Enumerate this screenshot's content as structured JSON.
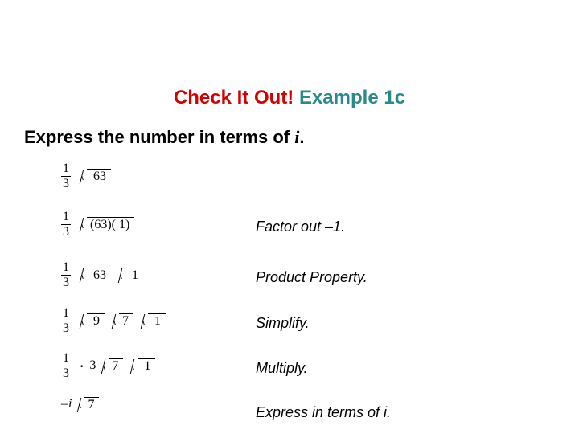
{
  "title": {
    "red": "Check It Out!",
    "teal": "Example 1c"
  },
  "prompt": {
    "a": "Express the number in terms of ",
    "i": "i",
    "b": "."
  },
  "frac": {
    "n": "1",
    "d": "3"
  },
  "rad": {
    "r1": " 63",
    "r2": "(63)( 1)",
    "r3a": " 63",
    "r3b": " 1",
    "r4a": " 9",
    "r4b": "7",
    "r4c": " 1",
    "r5_mid": "3",
    "r5a": "7",
    "r5b": " 1",
    "r6_pre": "–",
    "r6_i": "i",
    "r6a": "7"
  },
  "expl": {
    "e2": "Factor out –1.",
    "e3": "Product Property.",
    "e4": "Simplify.",
    "e5": "Multiply.",
    "e6": "Express in terms of i."
  }
}
